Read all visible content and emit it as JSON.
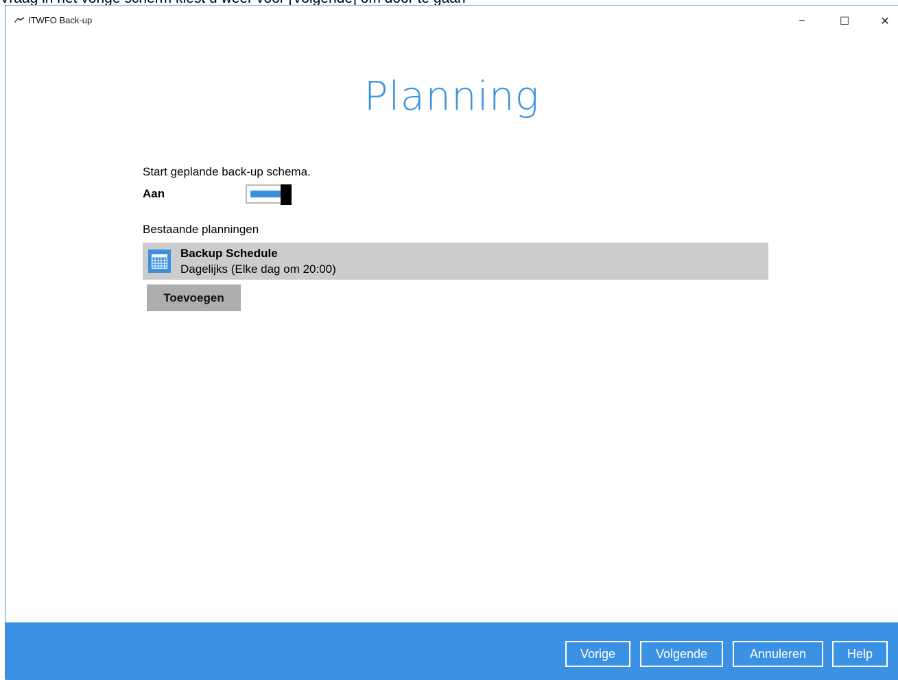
{
  "caption": "Vraag in het vorige scherm kiest u weer voor [Volgende] om door te gaan",
  "window": {
    "title": "ITWFO Back-up",
    "app_icon": "app-logo-icon",
    "controls": {
      "minimize": "−",
      "maximize": "☐",
      "close": "✕"
    }
  },
  "page": {
    "title": "Planning",
    "intro": "Start geplande back-up schema.",
    "toggle": {
      "label": "Aan",
      "state": "on",
      "accent": "#3b8fe0"
    },
    "existing_label": "Bestaande planningen",
    "schedules": [
      {
        "icon": "calendar-icon",
        "name": "Backup Schedule",
        "description": "Dagelijks (Elke dag om 20:00)"
      }
    ],
    "add_label": "Toevoegen"
  },
  "footer": {
    "background": "#3b91e3",
    "buttons": {
      "previous": "Vorige",
      "next": "Volgende",
      "cancel": "Annuleren",
      "help": "Help"
    }
  }
}
